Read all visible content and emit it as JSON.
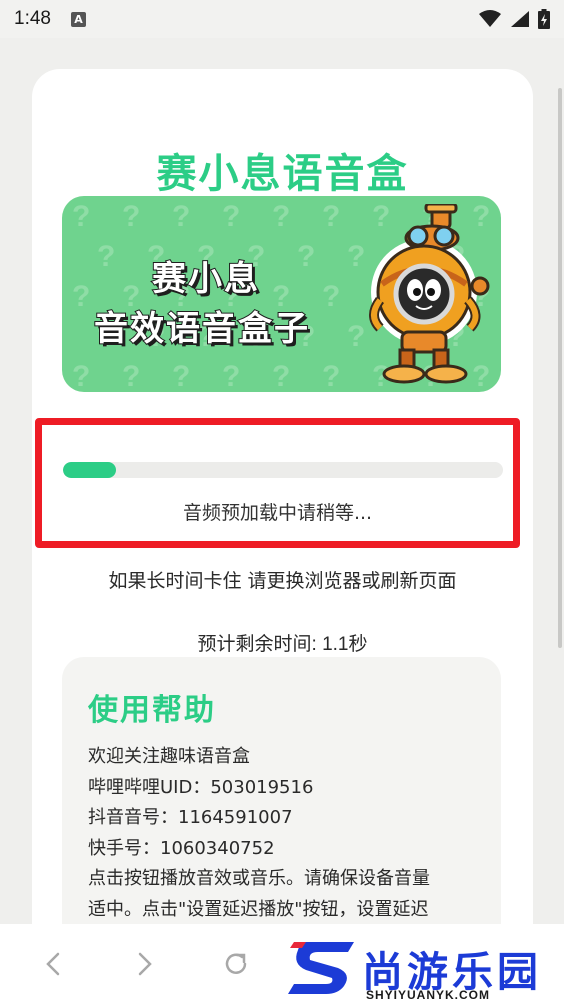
{
  "status_bar": {
    "time": "1:48",
    "notification_icon": "a-icon",
    "icons": [
      "wifi-icon",
      "signal-icon",
      "battery-charging-icon"
    ]
  },
  "app": {
    "title": "赛小息语音盒",
    "accent_color": "#2ccd86"
  },
  "banner": {
    "line1": "赛小息",
    "line2": "音效语音盒子",
    "background_color": "#6fd38e"
  },
  "loading": {
    "progress_percent": 12,
    "label": "音频预加载中请稍等...",
    "highlight_color": "#ee1c25"
  },
  "hint": "如果长时间卡住 请更换浏览器或刷新页面",
  "eta": {
    "label": "预计剩余时间: ",
    "value": "1.1秒"
  },
  "help": {
    "title": "使用帮助",
    "lines": [
      "欢迎关注趣味语音盒",
      "哔哩哔哩UID：503019516",
      "抖音音号：1164591007",
      "快手号：1060340752",
      "点击按钮播放音效或音乐。请确保设备音量",
      "适中。点击\"设置延迟播放\"按钮，设置延迟"
    ]
  },
  "bottom_nav": {
    "buttons": [
      "back-icon",
      "forward-icon",
      "reload-icon"
    ]
  },
  "watermark": {
    "brand": "尚游乐园",
    "url": "SHYIYUANYK.COM"
  }
}
